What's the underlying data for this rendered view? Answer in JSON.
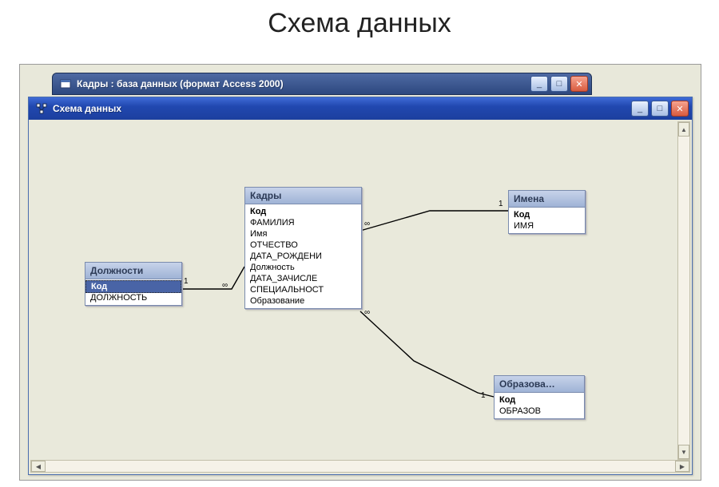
{
  "page_title": "Схема данных",
  "bg_window": {
    "title": "Кадры : база данных (формат Access 2000)",
    "controls": {
      "min": "_",
      "max": "□",
      "close": "✕"
    }
  },
  "schema_window": {
    "title": "Схема данных",
    "controls": {
      "min": "_",
      "max": "□",
      "close": "✕"
    }
  },
  "tables": {
    "dolzh": {
      "name": "Должности",
      "fields": [
        {
          "label": "Код",
          "pk": true,
          "selected": true
        },
        {
          "label": "ДОЛЖНОСТЬ"
        }
      ]
    },
    "kadry": {
      "name": "Кадры",
      "fields": [
        {
          "label": "Код",
          "pk": true
        },
        {
          "label": "ФАМИЛИЯ"
        },
        {
          "label": "Имя"
        },
        {
          "label": "ОТЧЕСТВО"
        },
        {
          "label": "ДАТА_РОЖДЕНИ"
        },
        {
          "label": "Должность"
        },
        {
          "label": "ДАТА_ЗАЧИСЛЕ"
        },
        {
          "label": "СПЕЦИАЛЬНОСТ"
        },
        {
          "label": "Образование"
        }
      ]
    },
    "imena": {
      "name": "Имена",
      "fields": [
        {
          "label": "Код",
          "pk": true
        },
        {
          "label": "ИМЯ"
        }
      ]
    },
    "obraz": {
      "name": "Образова…",
      "fields": [
        {
          "label": "Код",
          "pk": true
        },
        {
          "label": "ОБРАЗОВ"
        }
      ]
    }
  },
  "relationships": {
    "dolzh_kadry": {
      "left": "1",
      "right": "∞"
    },
    "kadry_imena": {
      "left": "∞",
      "right": "1"
    },
    "kadry_obraz": {
      "left": "∞",
      "right": "1"
    }
  },
  "scroll": {
    "up": "▲",
    "down": "▼",
    "left": "◀",
    "right": "▶"
  }
}
